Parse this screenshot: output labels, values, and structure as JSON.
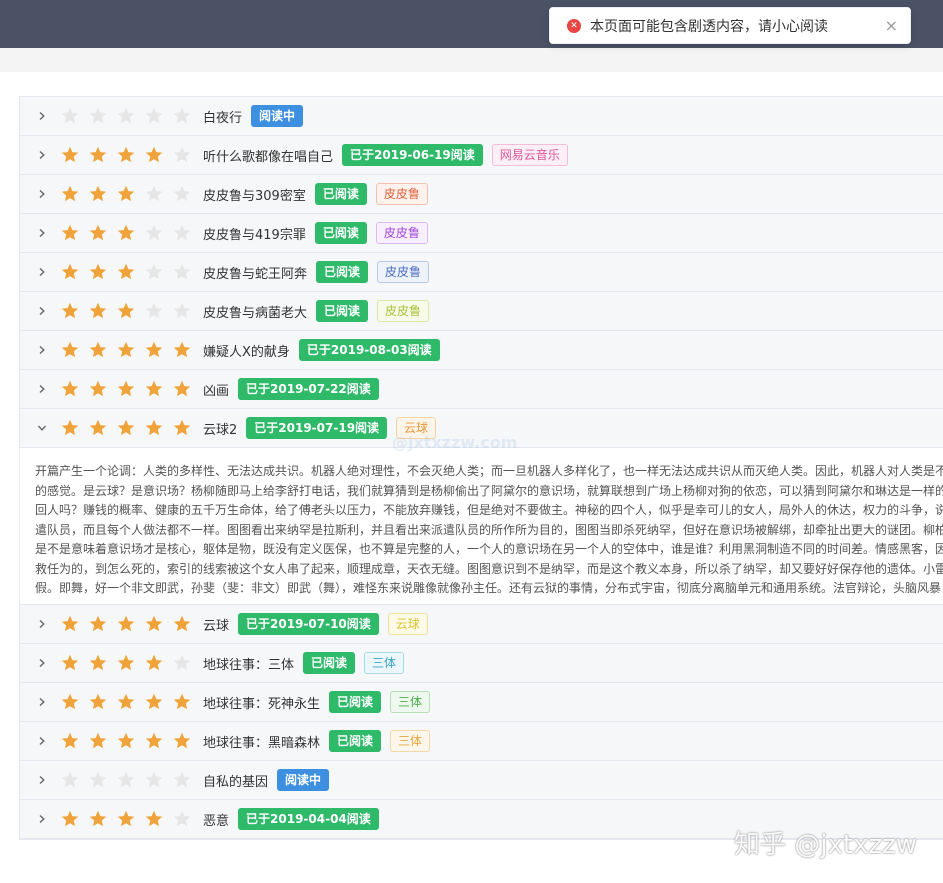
{
  "toast": {
    "message": "本页面可能包含剧透内容，请小心阅读",
    "close": "×",
    "icon": "error-icon"
  },
  "colors": {
    "star_on": "#f0a33a",
    "star_off": "#e6e6e6",
    "reading": "#3d8fe0",
    "read": "#2fba6a"
  },
  "books": [
    {
      "title": "白夜行",
      "rating": 0,
      "status": "阅读中",
      "status_kind": "reading",
      "tag": null
    },
    {
      "title": "听什么歌都像在唱自己",
      "rating": 4,
      "status": "已于2019-06-19阅读",
      "status_kind": "read",
      "tag": {
        "text": "网易云音乐",
        "color": "#e05599",
        "bg": "#fcf0f6",
        "border": "#f3bcd7"
      }
    },
    {
      "title": "皮皮鲁与309密室",
      "rating": 3,
      "status": "已阅读",
      "status_kind": "read",
      "tag": {
        "text": "皮皮鲁",
        "color": "#e0613a",
        "bg": "#fdf2ed",
        "border": "#f3c2ad"
      }
    },
    {
      "title": "皮皮鲁与419宗罪",
      "rating": 3,
      "status": "已阅读",
      "status_kind": "read",
      "tag": {
        "text": "皮皮鲁",
        "color": "#a348d8",
        "bg": "#f7effc",
        "border": "#dbbaf0"
      }
    },
    {
      "title": "皮皮鲁与蛇王阿奔",
      "rating": 3,
      "status": "已阅读",
      "status_kind": "read",
      "tag": {
        "text": "皮皮鲁",
        "color": "#4c6fbf",
        "bg": "#eef2fa",
        "border": "#b9c8e8"
      }
    },
    {
      "title": "皮皮鲁与病菌老大",
      "rating": 3,
      "status": "已阅读",
      "status_kind": "read",
      "tag": {
        "text": "皮皮鲁",
        "color": "#a8c23a",
        "bg": "#f8fbe9",
        "border": "#dbe9a4"
      }
    },
    {
      "title": "嫌疑人X的献身",
      "rating": 5,
      "status": "已于2019-08-03阅读",
      "status_kind": "read",
      "tag": null
    },
    {
      "title": "凶画",
      "rating": 5,
      "status": "已于2019-07-22阅读",
      "status_kind": "read",
      "tag": null
    },
    {
      "title": "云球2",
      "rating": 5,
      "status": "已于2019-07-19阅读",
      "status_kind": "read",
      "expanded": true,
      "tag": {
        "text": "云球",
        "color": "#e89a3c",
        "bg": "#fdf5ea",
        "border": "#f3d3a6"
      }
    },
    {
      "title": "云球",
      "rating": 5,
      "status": "已于2019-07-10阅读",
      "status_kind": "read",
      "tag": {
        "text": "云球",
        "color": "#d9c431",
        "bg": "#fdfbe8",
        "border": "#efe49c"
      }
    },
    {
      "title": "地球往事：三体",
      "rating": 4,
      "status": "已阅读",
      "status_kind": "read",
      "tag": {
        "text": "三体",
        "color": "#3aa4c7",
        "bg": "#ecf7fb",
        "border": "#acd9e9"
      }
    },
    {
      "title": "地球往事：死神永生",
      "rating": 5,
      "status": "已阅读",
      "status_kind": "read",
      "tag": {
        "text": "三体",
        "color": "#4cb04a",
        "bg": "#eef8ee",
        "border": "#b5dfb4"
      }
    },
    {
      "title": "地球往事：黑暗森林",
      "rating": 5,
      "status": "已阅读",
      "status_kind": "read",
      "tag": {
        "text": "三体",
        "color": "#e8a53c",
        "bg": "#fdf6ea",
        "border": "#f3d8a8"
      }
    },
    {
      "title": "自私的基因",
      "rating": 0,
      "status": "阅读中",
      "status_kind": "reading",
      "tag": null
    },
    {
      "title": "恶意",
      "rating": 4,
      "status": "已于2019-04-04阅读",
      "status_kind": "read",
      "tag": null
    }
  ],
  "detail_lines": [
    "开篇产生一个论调：人类的多样性、无法达成共识。机器人绝对理性，不会灭绝人类；而一旦机器人多样化了，也一样无法达成共识从而灭绝人类。因此，机器人对人类是不",
    "的感觉。是云球？是意识场？杨柳随即马上给李舒打电话，我们就算猜到是杨柳偷出了阿黛尔的意识场，就算联想到广场上杨柳对狗的依恋，可以猜到阿黛尔和琳达是一样的",
    "回人吗？赚钱的概率、健康的五千万生命体，给了傅老头以压力，不能放弃赚钱，但是绝对不要做主。神秘的四个人，似乎是幸可儿的女人，局外人的休达，权力的斗争，说",
    "遣队员，而且每个人做法都不一样。图图看出来纳罕是拉斯利，并且看出来派遣队员的所作所为目的，图图当即杀死纳罕，但好在意识场被解绑，却牵扯出更大的谜团。柳柏",
    "是不是意味着意识场才是核心，躯体是物，既没有定义医保，也不算是完整的人，一个人的意识场在另一个人的空体中，谁是谁？利用黑洞制造不同的时间差。情感黑客，因",
    "救任为的，到怎么死的，索引的线索被这个女人串了起来，顺理成章，天衣无缝。图图意识到不是纳罕，而是这个教义本身，所以杀了纳罕，却又要好好保存他的遗体。小雷",
    "假。即舞，好一个非文即武，孙斐（斐：非文）即武（舞），难怪东来说雕像就像孙主任。还有云狱的事情，分布式宇宙，彻底分离脑单元和通用系统。法官辩论，头脑风暴"
  ],
  "watermark": "@jxtxzzw.com",
  "footer_watermark": "知乎 @jxtxzzw"
}
